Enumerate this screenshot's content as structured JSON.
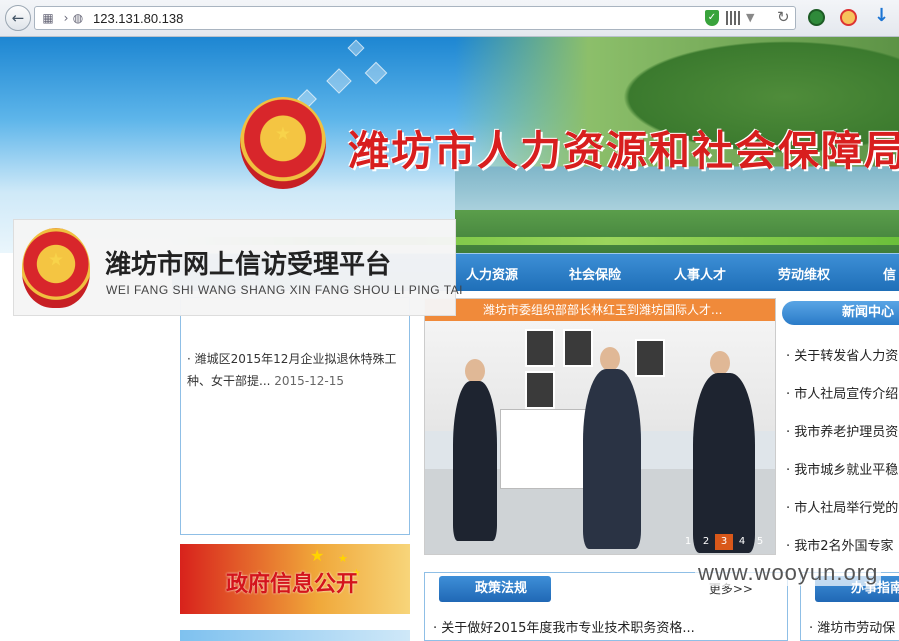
{
  "browser": {
    "url": "123.131.80.138"
  },
  "site": {
    "title": "潍坊市人力资源和社会保障局"
  },
  "nav": {
    "items": [
      "人力资源",
      "社会保险",
      "人事人才",
      "劳动维权",
      "信"
    ]
  },
  "overlay": {
    "title": "潍坊市网上信访受理平台",
    "subtitle": "WEI FANG SHI WANG SHANG XIN FANG SHOU LI PING TAI"
  },
  "notice": {
    "text": "· 潍城区2015年12月企业拟退休特殊工种、女干部提...",
    "date": "2015-12-15"
  },
  "gov_banner": {
    "label": "政府信息公开"
  },
  "slideshow": {
    "caption": "潍坊市委组织部部长林红玉到潍坊国际人才...",
    "pages": [
      "1",
      "2",
      "3",
      "4",
      "5"
    ],
    "active_page": "3"
  },
  "news_center": {
    "title": "新闻中心",
    "items": [
      "· 关于转发省人力资",
      "· 市人社局宣传介绍",
      "· 我市养老护理员资",
      "· 我市城乡就业平稳",
      "· 市人社局举行党的",
      "· 我市2名外国专家"
    ]
  },
  "policy": {
    "title": "政策法规",
    "more": "更多>>",
    "items": [
      "· 关于做好2015年度我市专业技术职务资格..."
    ]
  },
  "guide": {
    "title": "办事指南",
    "items": [
      "· 潍坊市劳动保"
    ]
  },
  "watermark": "www.wooyun.org",
  "colors": {
    "title_red": "#d81e1e",
    "nav_blue": "#2a7bc8",
    "caption_orange": "#f08a3a"
  }
}
